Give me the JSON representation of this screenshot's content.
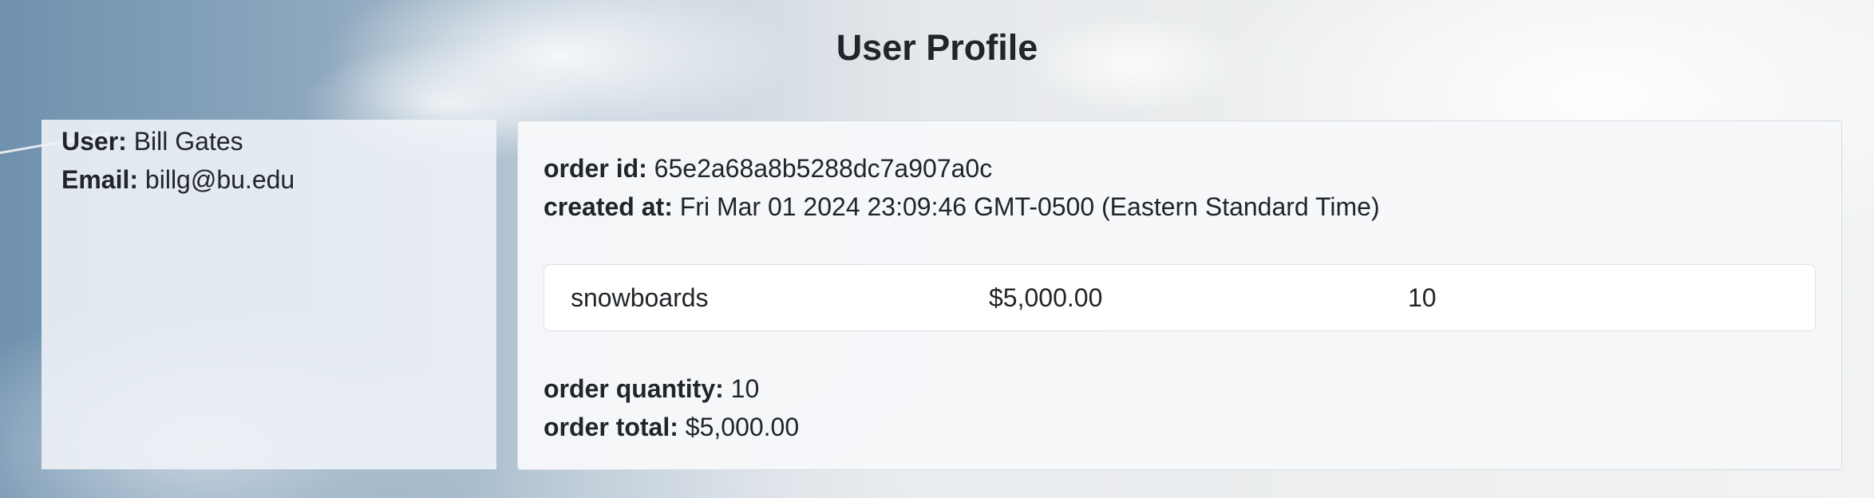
{
  "page": {
    "title": "User Profile"
  },
  "user": {
    "user_label": "User:",
    "user_value": "Bill Gates",
    "email_label": "Email:",
    "email_value": "billg@bu.edu"
  },
  "order": {
    "id_label": "order id:",
    "id_value": "65e2a68a8b5288dc7a907a0c",
    "created_label": "created at:",
    "created_value": "Fri Mar 01 2024 23:09:46 GMT-0500 (Eastern Standard Time)",
    "items": [
      {
        "name": "snowboards",
        "price": "$5,000.00",
        "quantity": "10"
      }
    ],
    "quantity_label": "order quantity:",
    "quantity_value": "10",
    "total_label": "order total:",
    "total_value": "$5,000.00"
  },
  "colors": {
    "text": "#212529",
    "card_background": "#f7f8fa"
  }
}
